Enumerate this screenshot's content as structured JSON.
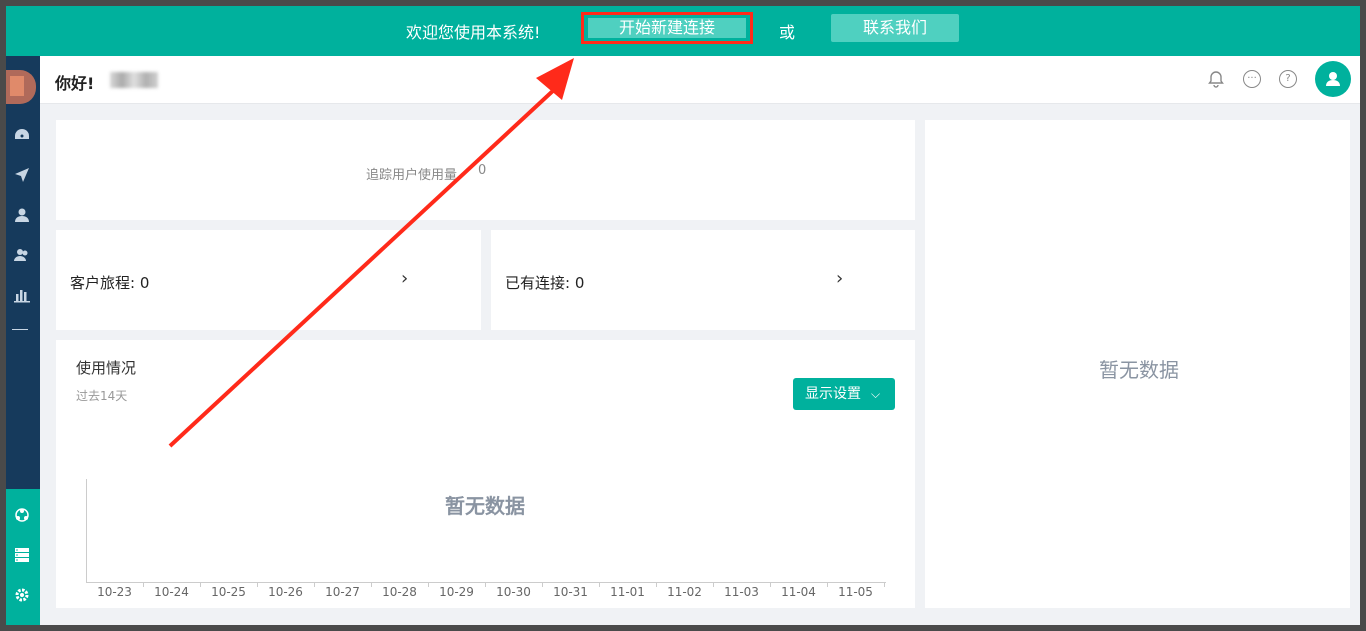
{
  "topbar": {
    "welcome": "欢迎您使用本系统!",
    "new_connection_button": "开始新建连接",
    "or": "或",
    "contact_button": "联系我们"
  },
  "header": {
    "greeting": "你好!"
  },
  "tracking": {
    "label": "追踪用户使用量",
    "value": "0"
  },
  "journey": {
    "label": "客户旅程: 0"
  },
  "connections": {
    "label": "已有连接: 0"
  },
  "usage": {
    "title": "使用情况",
    "subtitle": "过去14天",
    "display_settings_button": "显示设置",
    "empty_text": "暂无数据",
    "dates": [
      "10-23",
      "10-24",
      "10-25",
      "10-26",
      "10-27",
      "10-28",
      "10-29",
      "10-30",
      "10-31",
      "11-01",
      "11-02",
      "11-03",
      "11-04",
      "11-05"
    ]
  },
  "right_panel": {
    "empty_text": "暂无数据"
  },
  "colors": {
    "accent": "#00b19d",
    "sidebar": "#163a5c",
    "highlight": "#ff2a1a"
  }
}
